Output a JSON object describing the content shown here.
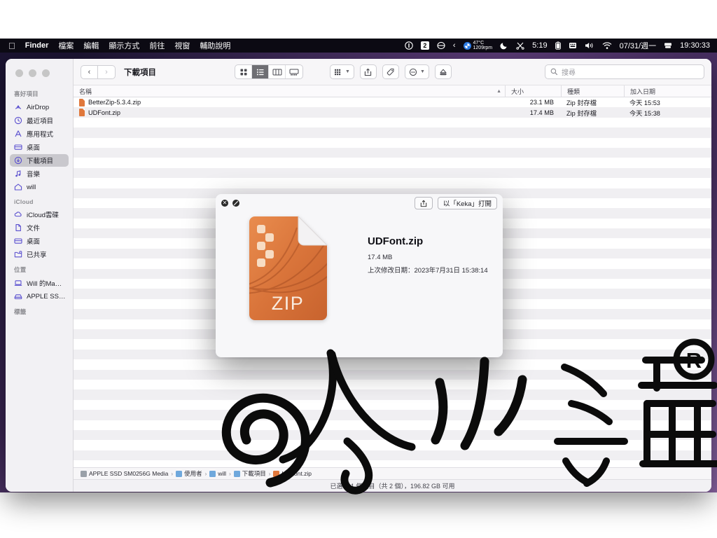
{
  "menubar": {
    "apple_icon": "apple-logo-icon",
    "items": [
      "Finder",
      "檔案",
      "編輯",
      "顯示方式",
      "前往",
      "視窗",
      "輔助說明"
    ],
    "status_items": [
      {
        "name": "info-icon",
        "glyph": "ⓘ"
      },
      {
        "name": "badge-two-icon",
        "glyph": "2"
      },
      {
        "name": "bartender-icon",
        "glyph": "⊜"
      },
      {
        "name": "chevron-left-icon",
        "glyph": "‹"
      },
      {
        "name": "fan-control-icon",
        "temp": "47°C",
        "rpm": "1209rpm"
      },
      {
        "name": "do-not-disturb-moon-icon",
        "glyph": "☾"
      },
      {
        "name": "scissors-icon",
        "glyph": "✂"
      },
      {
        "name": "timer-icon",
        "glyph": "5:19"
      },
      {
        "name": "battery-icon",
        "glyph": "▮"
      },
      {
        "name": "keyboard-icon",
        "glyph": "⌨"
      },
      {
        "name": "volume-icon",
        "glyph": "◀))"
      },
      {
        "name": "wifi-icon",
        "glyph": "wifi"
      },
      {
        "name": "date-display",
        "glyph": "07/31/週一"
      },
      {
        "name": "time-machine-icon",
        "glyph": "⌷"
      },
      {
        "name": "clock-display",
        "glyph": "19:30:33"
      }
    ]
  },
  "finder": {
    "title": "下載項目",
    "nav": {
      "back": "‹",
      "forward": "›"
    },
    "view_modes": [
      {
        "name": "icon-view",
        "active": false
      },
      {
        "name": "list-view",
        "active": true
      },
      {
        "name": "column-view",
        "active": false
      },
      {
        "name": "gallery-view",
        "active": false
      }
    ],
    "toolbar_buttons": [
      {
        "name": "group-by-button",
        "label": ""
      },
      {
        "name": "share-button",
        "label": ""
      },
      {
        "name": "tags-button",
        "label": ""
      },
      {
        "name": "action-menu-button",
        "label": ""
      },
      {
        "name": "eject-button",
        "label": ""
      }
    ],
    "search": {
      "placeholder": "搜尋",
      "value": ""
    },
    "columns": [
      "名稱",
      "大小",
      "種類",
      "加入日期"
    ],
    "files": [
      {
        "name": "BetterZip-5.3.4.zip",
        "size": "23.1 MB",
        "kind": "Zip 封存檔",
        "date": "今天 15:53",
        "selected": false
      },
      {
        "name": "UDFont.zip",
        "size": "17.4 MB",
        "kind": "Zip 封存檔",
        "date": "今天 15:38",
        "selected": true
      }
    ],
    "path_bar": [
      {
        "label": "APPLE SSD SM0256G Media",
        "icon": "drive-icon"
      },
      {
        "label": "使用者",
        "icon": "folder-icon"
      },
      {
        "label": "will",
        "icon": "folder-icon"
      },
      {
        "label": "下載項目",
        "icon": "folder-icon"
      },
      {
        "label": "UDFont.zip",
        "icon": "zip-icon"
      }
    ],
    "status": "已選取 1 個項目（共 2 個），196.82 GB 可用"
  },
  "sidebar": {
    "sections": [
      {
        "header": "喜好項目",
        "items": [
          {
            "label": "AirDrop",
            "icon": "airdrop-icon",
            "selected": false
          },
          {
            "label": "最近項目",
            "icon": "recents-clock-icon",
            "selected": false
          },
          {
            "label": "應用程式",
            "icon": "applications-icon",
            "selected": false
          },
          {
            "label": "桌面",
            "icon": "desktop-icon",
            "selected": false
          },
          {
            "label": "下載項目",
            "icon": "downloads-icon",
            "selected": true
          },
          {
            "label": "音樂",
            "icon": "music-note-icon",
            "selected": false
          },
          {
            "label": "will",
            "icon": "home-icon",
            "selected": false
          }
        ]
      },
      {
        "header": "iCloud",
        "items": [
          {
            "label": "iCloud雲碟",
            "icon": "cloud-icon",
            "selected": false
          },
          {
            "label": "文件",
            "icon": "document-icon",
            "selected": false
          },
          {
            "label": "桌面",
            "icon": "desktop-icon",
            "selected": false
          },
          {
            "label": "已共享",
            "icon": "shared-folder-icon",
            "selected": false
          }
        ]
      },
      {
        "header": "位置",
        "items": [
          {
            "label": "Will 的Ma…",
            "icon": "laptop-icon",
            "selected": false
          },
          {
            "label": "APPLE SS…",
            "icon": "external-drive-icon",
            "selected": false
          }
        ]
      },
      {
        "header": "標籤",
        "items": []
      }
    ]
  },
  "quicklook": {
    "close_label": "✕",
    "fullscreen_label": "⤢",
    "share_label": "",
    "open_with_button": "以「Keka」打開",
    "file_name": "UDFont.zip",
    "file_size": "17.4 MB",
    "modified": "上次修改日期：2023年7月31日 15:38:14",
    "icon_label": "ZIP"
  },
  "watermark": {
    "text": "人小編",
    "mark": "R"
  },
  "colors": {
    "accent": "#5a4fcf",
    "zip_orange": "#e0783c",
    "selected_row": "#f0eff2",
    "sidebar_bg": "#f2f1f4",
    "menubar_bg": "#0c0a13"
  }
}
